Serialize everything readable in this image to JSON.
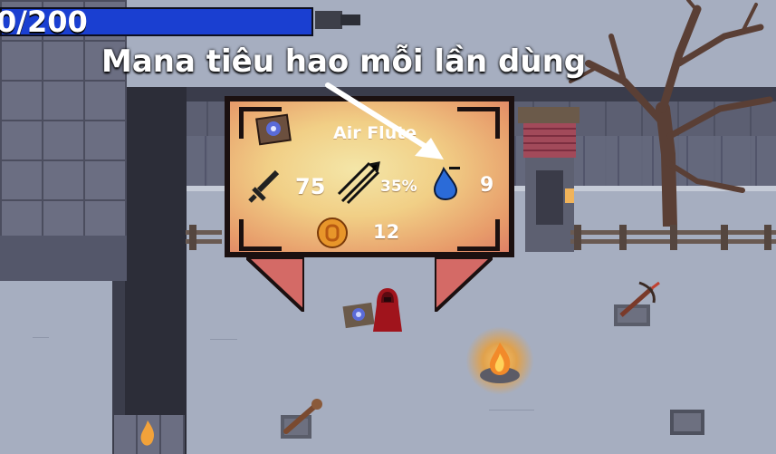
{
  "hud": {
    "health_text": "0/200",
    "health_fraction": 1.0,
    "health_color": "#1a3fd1"
  },
  "annotation": {
    "text": "Mana tiêu hao mỗi lần dùng"
  },
  "tooltip": {
    "title": "Air Flute",
    "item_icon": "air-flute-scroll-icon",
    "damage_icon": "sword-icon",
    "damage": "75",
    "crit_icon": "piercing-arrows-icon",
    "crit_chance": "35%",
    "mana_icon": "mana-drop-icon",
    "mana_cost": "9",
    "price_icon": "gold-coin-icon",
    "price": "12",
    "panel_color": "#f1cf86",
    "border_color": "#1b1010"
  },
  "world": {
    "player": "red-cloaked-player",
    "pickups": [
      "air-flute-pickup",
      "crossbow-pickup",
      "club-pickup",
      "pedestal"
    ],
    "campfire": "campfire"
  }
}
